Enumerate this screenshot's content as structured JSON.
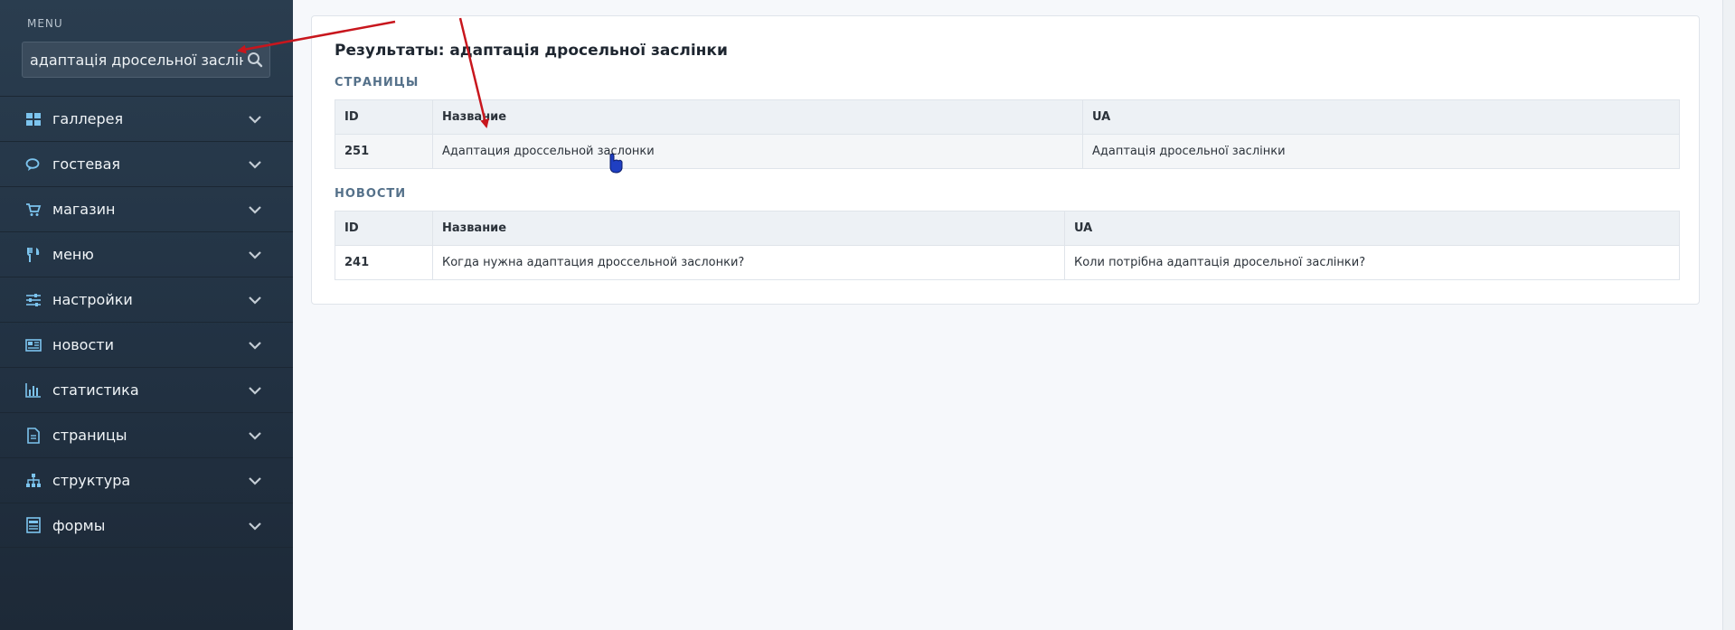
{
  "sidebar": {
    "caption": "MENU",
    "search": {
      "value": "адаптація дросельної заслінки",
      "placeholder": ""
    },
    "items": [
      {
        "label": "галлерея",
        "icon": "grid-icon"
      },
      {
        "label": "гостевая",
        "icon": "chat-icon"
      },
      {
        "label": "магазин",
        "icon": "cart-icon"
      },
      {
        "label": "меню",
        "icon": "utensils-icon"
      },
      {
        "label": "настройки",
        "icon": "sliders-icon"
      },
      {
        "label": "новости",
        "icon": "newspaper-icon"
      },
      {
        "label": "статистика",
        "icon": "bar-chart-icon"
      },
      {
        "label": "страницы",
        "icon": "file-icon"
      },
      {
        "label": "структура",
        "icon": "sitemap-icon"
      },
      {
        "label": "формы",
        "icon": "form-icon"
      }
    ]
  },
  "results": {
    "title": "Результаты: адаптація дросельної заслінки",
    "pages": {
      "heading": "СТРАНИЦЫ",
      "columns": [
        "ID",
        "Название",
        "UA"
      ],
      "rows": [
        {
          "id": "251",
          "name": "Адаптация дроссельной заслонки",
          "ua": "Адаптація дросельної заслінки"
        }
      ]
    },
    "news": {
      "heading": "НОВОСТИ",
      "columns": [
        "ID",
        "Название",
        "UA"
      ],
      "rows": [
        {
          "id": "241",
          "name": "Когда нужна адаптация дроссельной заслонки?",
          "ua": "Коли потрібна адаптація дросельної заслінки?"
        }
      ]
    }
  },
  "colors": {
    "sidebar_bg": "#223243",
    "accent_icon": "#7cc4ee",
    "annotation_arrow": "#c8161d",
    "cursor": "#1f3fc2"
  }
}
